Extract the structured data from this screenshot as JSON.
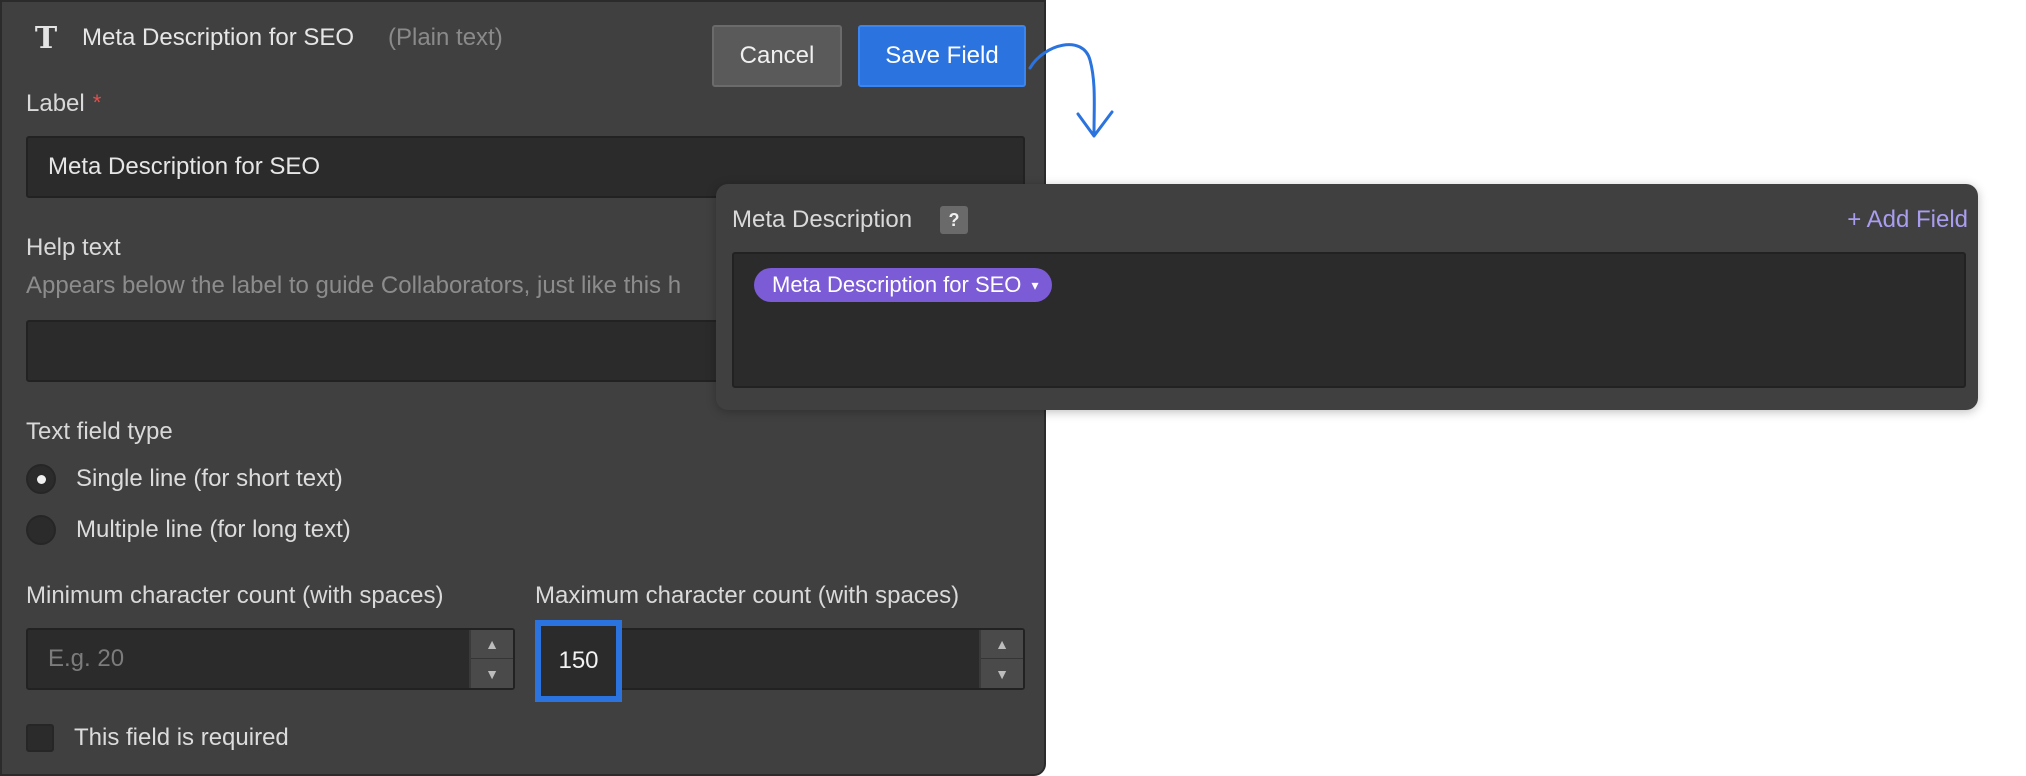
{
  "header": {
    "field_type_icon": "text-type-icon",
    "title": "Meta Description for SEO",
    "subtitle": "(Plain text)",
    "cancel_label": "Cancel",
    "save_label": "Save Field"
  },
  "form": {
    "label_heading": "Label",
    "required_marker": "*",
    "label_value": "Meta Description for SEO",
    "help_heading": "Help text",
    "help_description": "Appears below the label to guide Collaborators, just like this h",
    "help_value": "",
    "text_type_heading": "Text field type",
    "text_type_options": [
      {
        "label": "Single line (for short text)",
        "selected": true
      },
      {
        "label": "Multiple line (for long text)",
        "selected": false
      }
    ],
    "min_heading": "Minimum character count (with spaces)",
    "min_placeholder": "E.g. 20",
    "max_heading": "Maximum character count (with spaces)",
    "max_value": "150",
    "required_checkbox_label": "This field is required",
    "required_checked": false
  },
  "preview": {
    "title": "Meta Description",
    "help_icon": "?",
    "add_field_label": "+ Add Field",
    "tag_label": "Meta Description for SEO",
    "tag_icon": "chevron-down-icon"
  },
  "colors": {
    "panel_bg": "#404040",
    "input_bg": "#2b2b2b",
    "accent_blue": "#2b73de",
    "tag_purple": "#7b5bd6",
    "add_field_text": "#a99df0",
    "required_red": "#e0504c"
  }
}
